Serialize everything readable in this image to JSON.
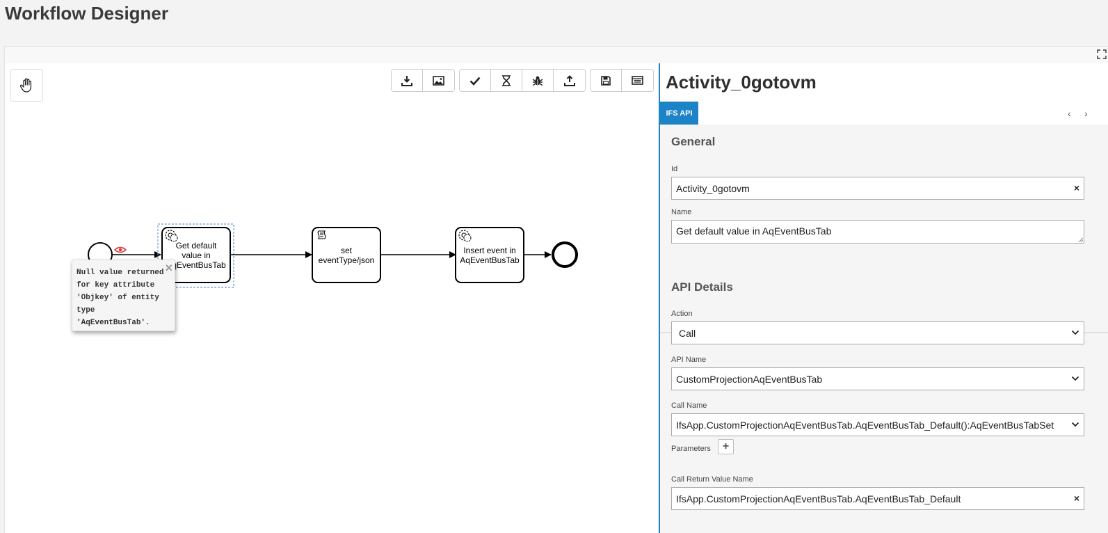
{
  "page": {
    "title": "Workflow Designer"
  },
  "toolbar": {
    "groups": [
      {
        "buttons": [
          {
            "icon": "download-icon"
          },
          {
            "icon": "image-icon"
          }
        ]
      },
      {
        "buttons": [
          {
            "icon": "check-icon"
          },
          {
            "icon": "hourglass-icon"
          },
          {
            "icon": "bug-icon"
          },
          {
            "icon": "upload-icon"
          }
        ]
      },
      {
        "buttons": [
          {
            "icon": "save-icon"
          },
          {
            "icon": "list-icon"
          }
        ]
      }
    ],
    "hand_tool_icon": "hand-icon"
  },
  "diagram": {
    "tasks": [
      {
        "id": "task-1",
        "label": "Get default value in AqEventBusTab",
        "type": "service-task"
      },
      {
        "id": "task-2",
        "label": "set eventType/json",
        "type": "script-task"
      },
      {
        "id": "task-3",
        "label": "Insert event in AqEventBusTab",
        "type": "service-task"
      }
    ],
    "tooltip": {
      "text": "Null value returned\nfor key attribute\n'Objkey' of entity\ntype\n'AqEventBusTab'.",
      "close": "×"
    }
  },
  "panel": {
    "title": "Activity_0gotovm",
    "tab": "IFS API",
    "nav_prev": "‹",
    "nav_next": "›",
    "general": {
      "heading": "General",
      "id_label": "Id",
      "id_value": "Activity_0gotovm",
      "name_label": "Name",
      "name_value": "Get default value in AqEventBusTab"
    },
    "api": {
      "heading": "API Details",
      "action_label": "Action",
      "action_value": "Call",
      "api_name_label": "API Name",
      "api_name_value": "CustomProjectionAqEventBusTab",
      "call_name_label": "Call Name",
      "call_name_value": "IfsApp.CustomProjectionAqEventBusTab.AqEventBusTab_Default():AqEventBusTabSet",
      "parameters_label": "Parameters",
      "add_param": "+",
      "return_label": "Call Return Value Name",
      "return_value": "IfsApp.CustomProjectionAqEventBusTab.AqEventBusTab_Default"
    },
    "clear_symbol": "×"
  }
}
